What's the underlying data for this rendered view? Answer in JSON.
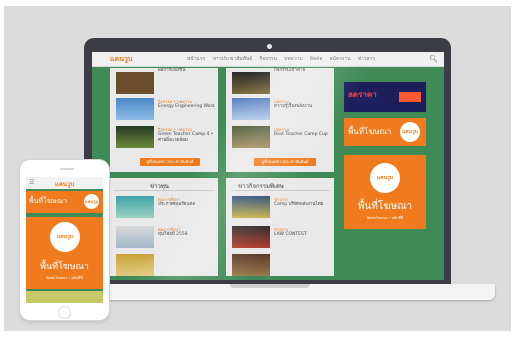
{
  "site": {
    "logo": "แคนวูบ",
    "nav": [
      "หน้าแรก",
      "ข่าวประชาสัมพันธ์",
      "กิจกรรม",
      "บทความ",
      "ติดต่อ",
      "สมัครงาน",
      "ข่าวสาร"
    ],
    "search_icon": "search-icon"
  },
  "left_column": {
    "items": [
      {
        "date": "กิจกรรม • บทความ",
        "title": "Energy Engineering Work"
      },
      {
        "date": "กิจกรรม • บทความ",
        "title": "Green Teacher Camp 4 • ค่ายสิ่งแวดล้อม"
      }
    ],
    "button": "ดูทั้งหมดข่าวประชาสัมพันธ์",
    "section2_title": "ข่าวทุน",
    "section2_items": [
      {
        "date": "ทุนการศึกษา",
        "title": "ประกาศทุนเรียนต่อ"
      },
      {
        "date": "ทุนการศึกษา",
        "title": "ทุนวิจัยปี 2558"
      }
    ]
  },
  "middle_column": {
    "items": [
      {
        "date": "บทความ",
        "title": "ความรู้เรื่องพลังงาน"
      },
      {
        "date": "บทความ",
        "title": "ตรวจสุขภาพโรงเรียน"
      },
      {
        "date": "บทความ",
        "title": "Best Teacher Camp Cup"
      }
    ],
    "button": "ดูทั้งหมดข่าวประชาสัมพันธ์",
    "section2_title": "ข่าวกิจกรรมพิเศษ",
    "section2_items": [
      {
        "date": "ข่าวสาร",
        "title": "Camp บริษัทพลังงานไทย"
      },
      {
        "date": "ข่าวสาร",
        "title": "LAW CONTEST"
      }
    ]
  },
  "right_column": {
    "ad_top_text": "ลดราคา",
    "ad2_text": "พื้นที่โฆษณา",
    "ad2_badge": "แคนวูบ",
    "big_ad_badge": "แคนวูบ",
    "big_ad_title": "พื้นที่โฆษณา",
    "big_ad_sub": "ติดต่อโฆษณา • คลิกที่นี่"
  },
  "phone": {
    "menu_icon": "menu-icon",
    "logo": "แคนวูบ",
    "ad1_text": "พื้นที่โฆษณา",
    "ad1_badge": "แคนวูบ",
    "ad2_badge": "แคนวูบ",
    "ad2_title": "พื้นที่โฆษณา",
    "ad2_sub": "ติดต่อโฆษณา • คลิกที่นี่"
  },
  "colors": {
    "brand_orange": "#f07b1e",
    "page_green": "#3f8a57"
  }
}
